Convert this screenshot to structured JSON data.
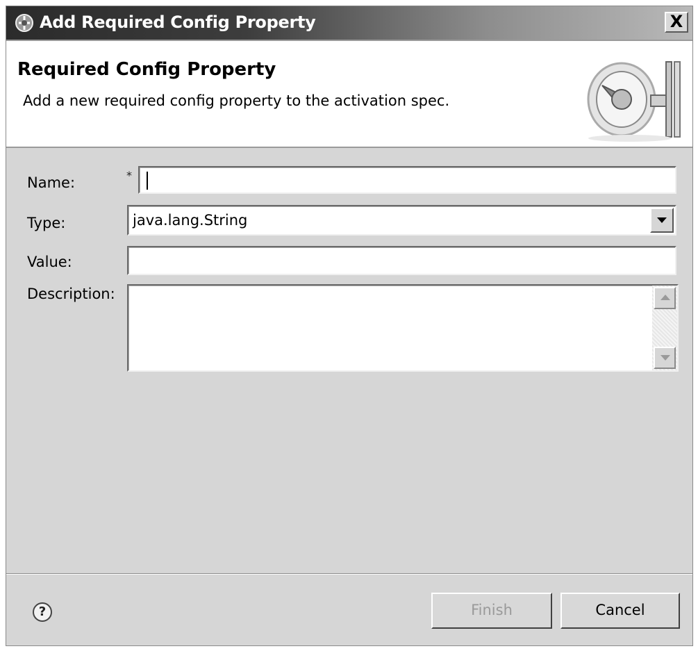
{
  "window": {
    "title": "Add Required Config Property",
    "close_label": "X"
  },
  "header": {
    "title": "Required Config Property",
    "description": "Add a new required config property to the activation spec."
  },
  "form": {
    "name": {
      "label": "Name:",
      "required_marker": "*",
      "value": ""
    },
    "type": {
      "label": "Type:",
      "selected": "java.lang.String"
    },
    "value": {
      "label": "Value:",
      "value": ""
    },
    "description": {
      "label": "Description:",
      "value": ""
    }
  },
  "footer": {
    "help_symbol": "?",
    "finish_label": "Finish",
    "cancel_label": "Cancel"
  },
  "colors": {
    "titlebar_start": "#2b2b2b",
    "dialog_bg": "#d6d6d6",
    "disabled_text": "#9a9a9a"
  }
}
